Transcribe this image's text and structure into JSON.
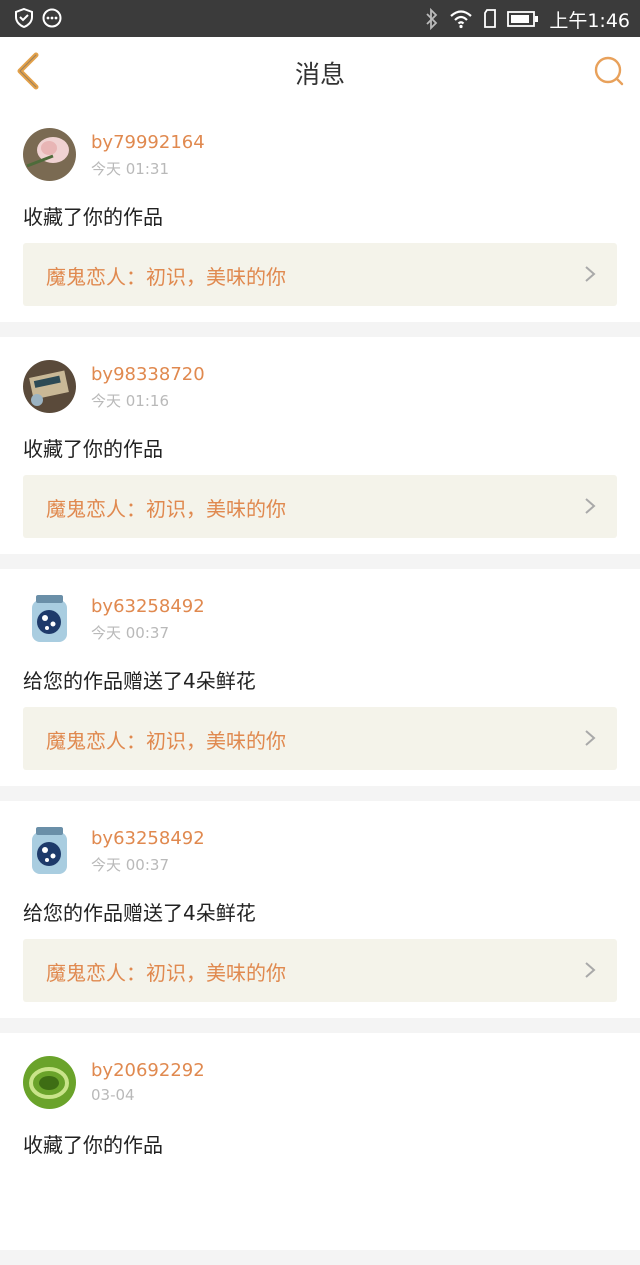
{
  "status_bar": {
    "time": "上午1:46"
  },
  "header": {
    "title": "消息"
  },
  "messages": [
    {
      "username": "by79992164",
      "time": "今天 01:31",
      "action": "收藏了你的作品",
      "work_title": "魔鬼恋人：初识，美味的你"
    },
    {
      "username": "by98338720",
      "time": "今天 01:16",
      "action": "收藏了你的作品",
      "work_title": "魔鬼恋人：初识，美味的你"
    },
    {
      "username": "by63258492",
      "time": "今天 00:37",
      "action": "给您的作品赠送了4朵鲜花",
      "work_title": "魔鬼恋人：初识，美味的你"
    },
    {
      "username": "by63258492",
      "time": "今天 00:37",
      "action": "给您的作品赠送了4朵鲜花",
      "work_title": "魔鬼恋人：初识，美味的你"
    },
    {
      "username": "by20692292",
      "time": "03-04",
      "action": "收藏了你的作品"
    }
  ],
  "colors": {
    "accent": "#e0894f",
    "link_bg": "#f4f3ea",
    "status_bg": "#3b3b3b"
  }
}
